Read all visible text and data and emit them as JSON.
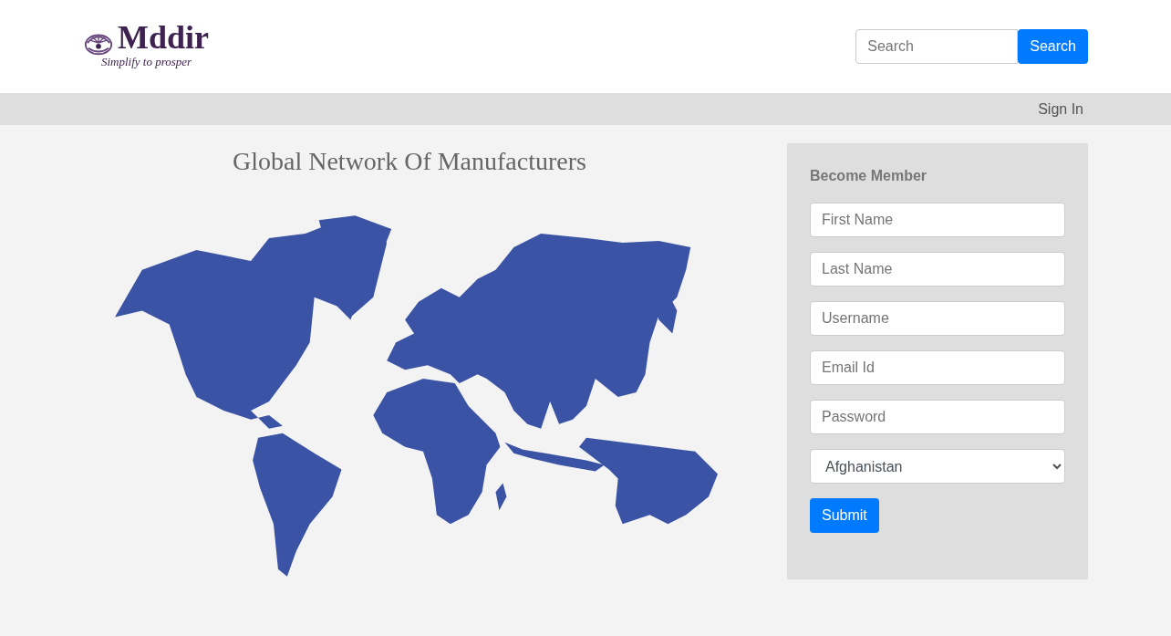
{
  "logo": {
    "name": "Mddir",
    "tagline": "Simplify to prosper"
  },
  "search": {
    "placeholder": "Search",
    "button": "Search"
  },
  "nav": {
    "sign_in": "Sign In"
  },
  "title": "Global Network Of Manufacturers",
  "form": {
    "heading": "Become Member",
    "fields": [
      {
        "placeholder": "First Name",
        "kind": "text"
      },
      {
        "placeholder": "Last Name",
        "kind": "text"
      },
      {
        "placeholder": "Username",
        "kind": "text"
      },
      {
        "placeholder": "Email Id",
        "kind": "text"
      },
      {
        "placeholder": "Password",
        "kind": "password"
      },
      {
        "value": "Afghanistan",
        "kind": "select"
      }
    ],
    "submit": "Submit"
  }
}
